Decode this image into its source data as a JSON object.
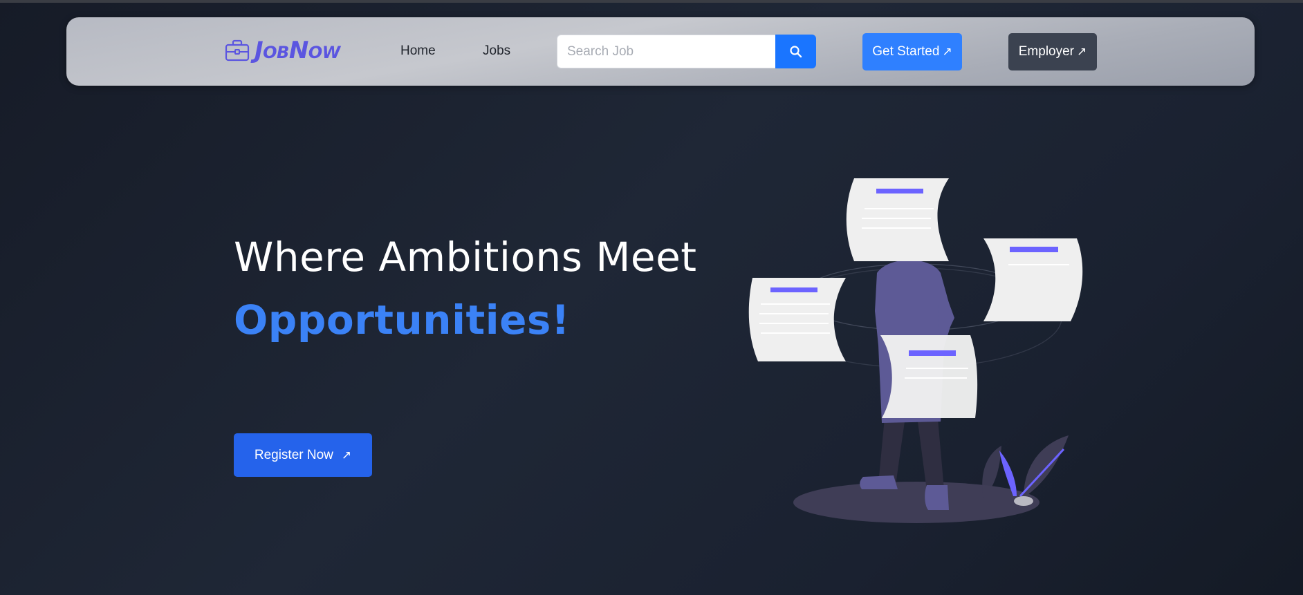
{
  "brand": {
    "name": "JobNow",
    "color": "#5b55e0"
  },
  "nav": {
    "links": [
      {
        "label": "Home"
      },
      {
        "label": "Jobs"
      }
    ]
  },
  "search": {
    "placeholder": "Search Job",
    "value": "",
    "button_icon": "search-icon",
    "button_color": "#1a75ff"
  },
  "actions": {
    "get_started": {
      "label": "Get Started",
      "icon": "arrow-up-right-icon",
      "color": "#2f80ff"
    },
    "employer": {
      "label": "Employer",
      "icon": "arrow-up-right-icon",
      "color": "#3b4250"
    }
  },
  "hero": {
    "headline": "Where Ambitions Meet",
    "highlight": "Opportunities!",
    "highlight_color": "#3b82f6",
    "cta": {
      "label": "Register Now",
      "icon": "arrow-up-right-icon",
      "color": "#2563eb"
    }
  },
  "illustration": {
    "name": "person-with-resumes-illustration",
    "accent": "#6c63ff"
  }
}
